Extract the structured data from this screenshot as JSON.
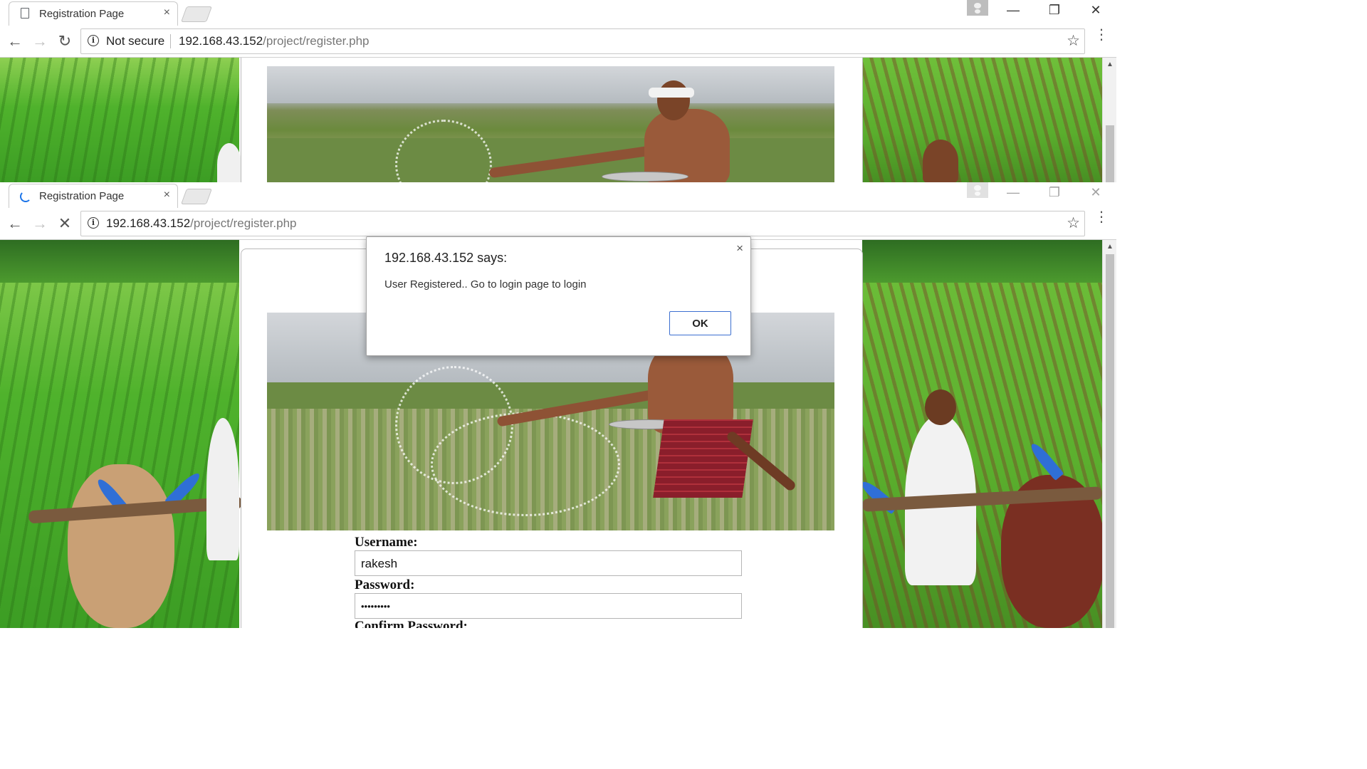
{
  "back_window": {
    "tab": {
      "title": "Registration Page",
      "close_glyph": "×"
    },
    "address": {
      "security_label": "Not secure",
      "url_host": "192.168.43.152",
      "url_path": "/project/register.php"
    }
  },
  "front_window": {
    "tab": {
      "title": "Registration Page",
      "close_glyph": "×"
    },
    "address": {
      "url_host": "192.168.43.152",
      "url_path": "/project/register.php"
    }
  },
  "window_controls": {
    "minimize": "—",
    "restore": "❐",
    "close": "✕"
  },
  "nav_glyphs": {
    "back": "←",
    "forward": "→",
    "reload": "↻",
    "stop": "✕",
    "star": "☆",
    "menu": "⋮",
    "info": "i",
    "scroll_up": "▲"
  },
  "dialog": {
    "title": "192.168.43.152 says:",
    "message": "User Registered.. Go to login page to login",
    "ok_label": "OK",
    "close_glyph": "×"
  },
  "form": {
    "username_label": "Username:",
    "username_value": "rakesh",
    "password_label": "Password:",
    "password_value": "•••••••••",
    "confirm_label": "Confirm Password:"
  },
  "colors": {
    "accent": "#3c6fd0",
    "field_green": "#4fb22c",
    "loading_blue": "#1a73e8"
  }
}
